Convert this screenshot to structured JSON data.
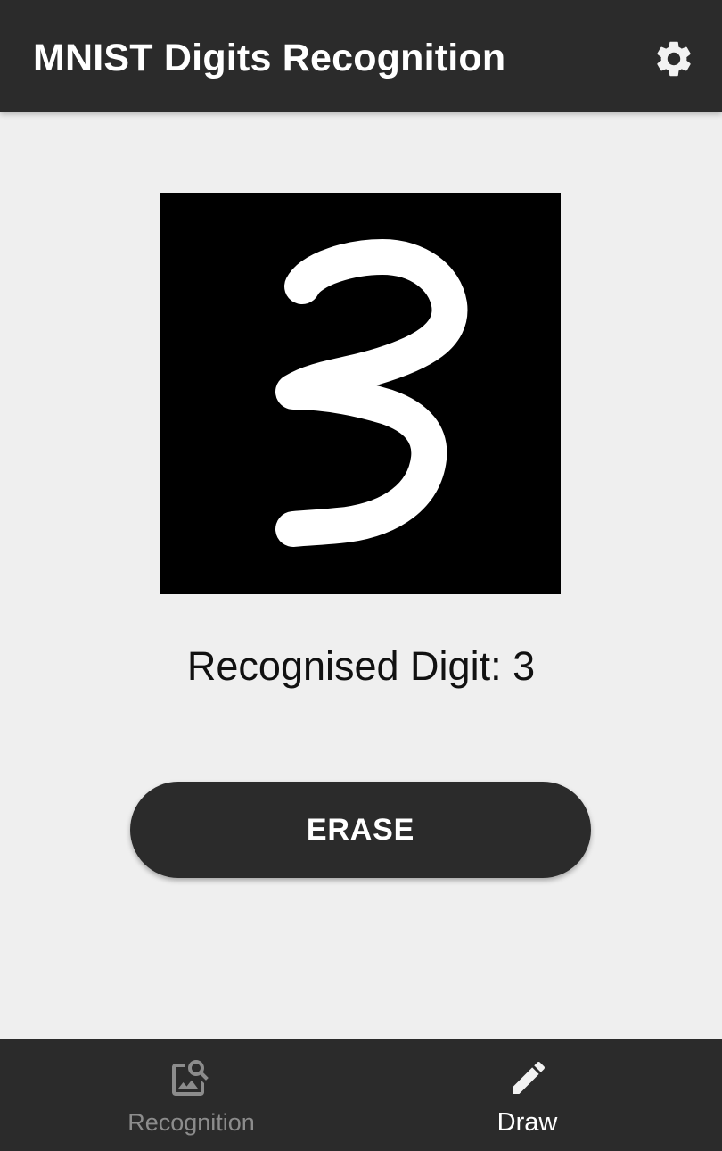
{
  "app_bar": {
    "title": "MNIST Digits Recognition",
    "settings_icon": "gear-icon"
  },
  "canvas": {
    "drawn_digit": "3",
    "background_color": "#000000",
    "stroke_color": "#ffffff"
  },
  "result": {
    "text": "Recognised Digit: 3"
  },
  "erase_button": {
    "label": "ERASE"
  },
  "bottom_nav": {
    "items": [
      {
        "label": "Recognition",
        "icon": "image-search-icon",
        "selected": false
      },
      {
        "label": "Draw",
        "icon": "pencil-icon",
        "selected": true
      }
    ]
  },
  "colors": {
    "bar_background": "#2b2b2b",
    "page_background": "#efefef",
    "nav_inactive": "#8c8c8c",
    "nav_active": "#ffffff"
  }
}
